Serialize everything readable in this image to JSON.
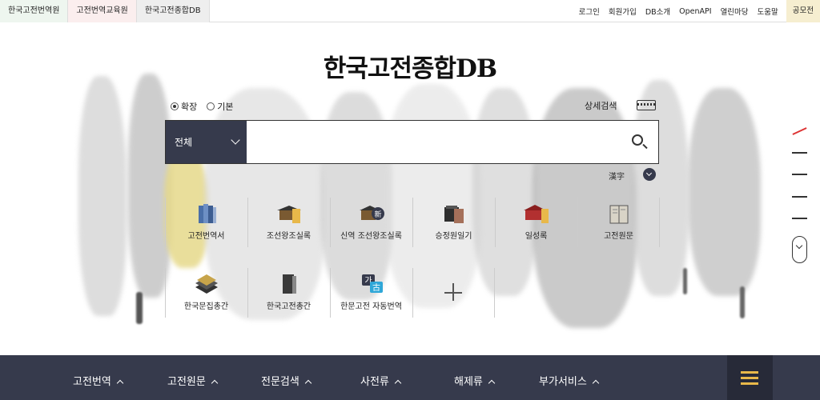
{
  "top_bar": {
    "site_tabs": [
      "한국고전번역원",
      "고전번역교육원",
      "한국고전종합DB"
    ],
    "links": [
      "로그인",
      "회원가입",
      "DB소개",
      "OpenAPI",
      "열린마당",
      "도움말"
    ],
    "contest_label": "공모전"
  },
  "title": "한국고전종합DB",
  "search": {
    "mode_options": [
      "확장",
      "기본"
    ],
    "selected_mode": "확장",
    "advanced_label": "상세검색",
    "scope_label": "전체",
    "value": "",
    "hanja_label": "漢字"
  },
  "databases": [
    {
      "label": "고전번역서",
      "icon": "books-icon"
    },
    {
      "label": "조선왕조실록",
      "icon": "palace-scroll-icon"
    },
    {
      "label": "신역 조선왕조실록",
      "icon": "palace-new-icon"
    },
    {
      "label": "승정원일기",
      "icon": "diary-icon"
    },
    {
      "label": "일성록",
      "icon": "red-building-icon"
    },
    {
      "label": "고전원문",
      "icon": "open-book-icon"
    },
    {
      "label": "한국문집총간",
      "icon": "book-stack-icon"
    },
    {
      "label": "한국고전총간",
      "icon": "single-volume-icon"
    },
    {
      "label": "한문고전 자동번역",
      "icon": "translate-icon"
    }
  ],
  "bottom_nav": [
    "고전번역",
    "고전원문",
    "전문검색",
    "사전류",
    "해제류",
    "부가서비스"
  ],
  "colors": {
    "navy": "#363a4c",
    "accent_gold": "#e8b84a",
    "active_red": "#d33333"
  }
}
